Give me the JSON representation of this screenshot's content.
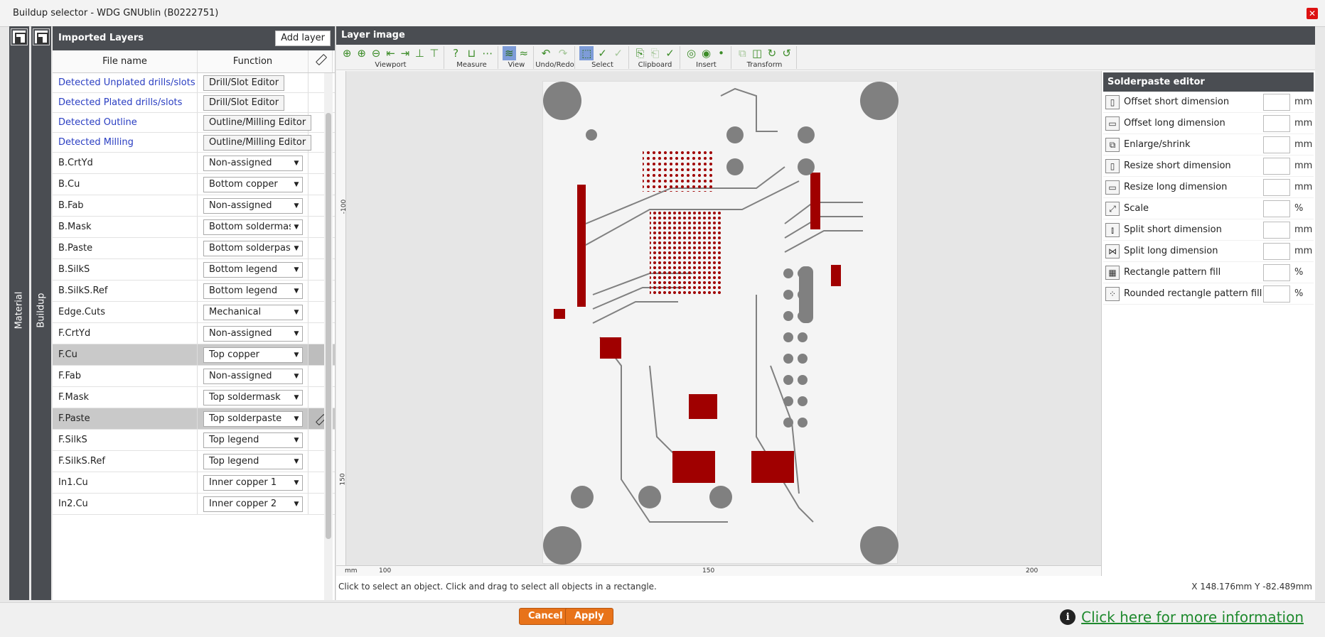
{
  "window": {
    "title": "Buildup selector - WDG GNUblin (B0222751)",
    "close_glyph": "✕"
  },
  "strips": {
    "material_label": "Material",
    "buildup_label": "Buildup"
  },
  "layers_panel": {
    "title": "Imported Layers",
    "add_layer": "Add layer",
    "col_file": "File name",
    "col_function": "Function",
    "rows": [
      {
        "name": "Detected Unplated drills/slots",
        "kind": "button",
        "value": "Drill/Slot Editor",
        "link": true
      },
      {
        "name": "Detected Plated drills/slots",
        "kind": "button",
        "value": "Drill/Slot Editor",
        "link": true
      },
      {
        "name": "Detected Outline",
        "kind": "button",
        "value": "Outline/Milling Editor",
        "link": true
      },
      {
        "name": "Detected Milling",
        "kind": "button",
        "value": "Outline/Milling Editor",
        "link": true
      },
      {
        "name": "B.CrtYd",
        "kind": "select",
        "value": "Non-assigned"
      },
      {
        "name": "B.Cu",
        "kind": "select",
        "value": "Bottom copper"
      },
      {
        "name": "B.Fab",
        "kind": "select",
        "value": "Non-assigned"
      },
      {
        "name": "B.Mask",
        "kind": "select",
        "value": "Bottom soldermask"
      },
      {
        "name": "B.Paste",
        "kind": "select",
        "value": "Bottom solderpaste"
      },
      {
        "name": "B.SilkS",
        "kind": "select",
        "value": "Bottom legend"
      },
      {
        "name": "B.SilkS.Ref",
        "kind": "select",
        "value": "Bottom legend"
      },
      {
        "name": "Edge.Cuts",
        "kind": "select",
        "value": "Mechanical"
      },
      {
        "name": "F.CrtYd",
        "kind": "select",
        "value": "Non-assigned"
      },
      {
        "name": "F.Cu",
        "kind": "select",
        "value": "Top copper",
        "selected": true
      },
      {
        "name": "F.Fab",
        "kind": "select",
        "value": "Non-assigned"
      },
      {
        "name": "F.Mask",
        "kind": "select",
        "value": "Top soldermask"
      },
      {
        "name": "F.Paste",
        "kind": "select",
        "value": "Top solderpaste",
        "selected": true,
        "edit": true
      },
      {
        "name": "F.SilkS",
        "kind": "select",
        "value": "Top legend"
      },
      {
        "name": "F.SilkS.Ref",
        "kind": "select",
        "value": "Top legend"
      },
      {
        "name": "In1.Cu",
        "kind": "select",
        "value": "Inner copper 1"
      },
      {
        "name": "In2.Cu",
        "kind": "select",
        "value": "Inner copper 2"
      }
    ]
  },
  "layer_image": {
    "title": "Layer image",
    "groups": [
      {
        "label": "Viewport",
        "icons": [
          "zoom-fit-icon",
          "zoom-in-icon",
          "zoom-out-icon",
          "fit-width-icon",
          "fit-height-icon",
          "move-up-icon",
          "move-down-icon"
        ]
      },
      {
        "label": "Measure",
        "icons": [
          "help-icon",
          "measure-icon",
          "measure-dist-icon"
        ]
      },
      {
        "label": "View",
        "icons": [
          "view-layers-icon",
          "view-stack-icon"
        ]
      },
      {
        "label": "Undo/Redo",
        "icons": [
          "undo-icon",
          "redo-icon"
        ]
      },
      {
        "label": "Select",
        "icons": [
          "select-rect-icon",
          "select-check-icon",
          "select-all-icon"
        ]
      },
      {
        "label": "Clipboard",
        "icons": [
          "copy-icon",
          "paste-icon",
          "delete-icon"
        ]
      },
      {
        "label": "Insert",
        "icons": [
          "insert-pad-icon",
          "insert-via-icon",
          "insert-point-icon"
        ]
      },
      {
        "label": "Transform",
        "icons": [
          "transform-move-icon",
          "mirror-icon",
          "rotate-cw-icon",
          "rotate-ccw-icon"
        ]
      }
    ],
    "ruler_h": [
      "mm",
      "100",
      "150",
      "200"
    ],
    "ruler_v": [
      "-100",
      "150"
    ],
    "status": "Click to select an object. Click and drag to select all objects in a rectangle.",
    "coords": "X 148.176mm  Y -82.489mm"
  },
  "solderpaste": {
    "title": "Solderpaste editor",
    "rows": [
      {
        "label": "Offset short dimension",
        "unit": "mm",
        "icon": "offset-short-icon",
        "glyph": "▯"
      },
      {
        "label": "Offset long dimension",
        "unit": "mm",
        "icon": "offset-long-icon",
        "glyph": "▭"
      },
      {
        "label": "Enlarge/shrink",
        "unit": "mm",
        "icon": "enlarge-shrink-icon",
        "glyph": "⧉"
      },
      {
        "label": "Resize short dimension",
        "unit": "mm",
        "icon": "resize-short-icon",
        "glyph": "▯"
      },
      {
        "label": "Resize long dimension",
        "unit": "mm",
        "icon": "resize-long-icon",
        "glyph": "▭"
      },
      {
        "label": "Scale",
        "unit": "%",
        "icon": "scale-icon",
        "glyph": "⤢"
      },
      {
        "label": "Split short dimension",
        "unit": "mm",
        "icon": "split-short-icon",
        "glyph": "⫾"
      },
      {
        "label": "Split long dimension",
        "unit": "mm",
        "icon": "split-long-icon",
        "glyph": "⋈"
      },
      {
        "label": "Rectangle pattern fill",
        "unit": "%",
        "icon": "rect-pattern-icon",
        "glyph": "▦"
      },
      {
        "label": "Rounded rectangle pattern fill",
        "unit": "%",
        "icon": "rounded-pattern-icon",
        "glyph": "⁘"
      }
    ]
  },
  "footer": {
    "cancel": "Cancel",
    "apply": "Apply",
    "info": "Click here for more information"
  },
  "colors": {
    "accent": "#e8731a",
    "panel_header": "#4a4d52",
    "copper_red": "#a00000",
    "pad_gray": "#808080"
  }
}
